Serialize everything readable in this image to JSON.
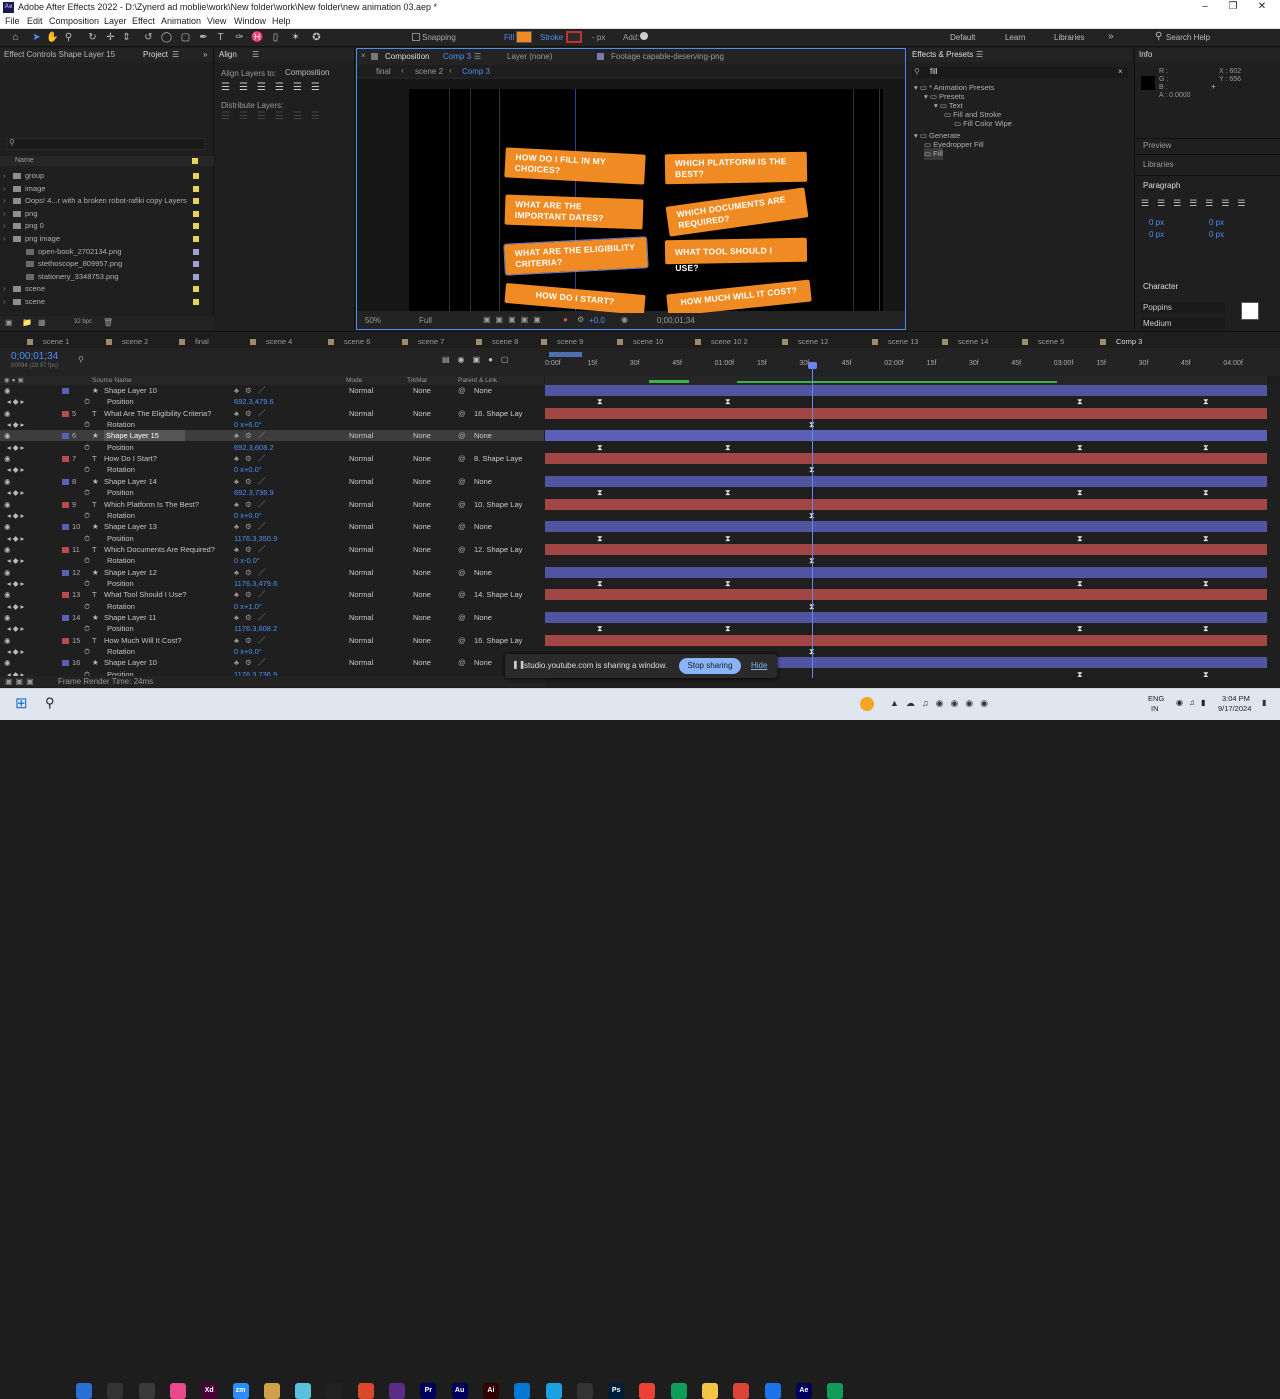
{
  "window": {
    "title": "Adobe After Effects 2022 - D:\\Zynerd ad moblie\\work\\New folder\\work\\New folder\\new animation 03.aep *",
    "app_icon": "Ae"
  },
  "menu": [
    "File",
    "Edit",
    "Composition",
    "Layer",
    "Effect",
    "Animation",
    "View",
    "Window",
    "Help"
  ],
  "toolbar": {
    "snapping": "Snapping",
    "fill": "Fill",
    "stroke": "Stroke",
    "stroke_px": "- px",
    "add": "Add:",
    "workspaces": [
      "Default",
      "Learn",
      "Libraries"
    ],
    "search": "Search Help"
  },
  "left_panel": {
    "effect_controls": "Effect Controls Shape Layer 15",
    "project": "Project",
    "search_placeholder": "",
    "col_name": "Name",
    "items": [
      {
        "name": "group",
        "type": "folder",
        "color": "#e6d45a"
      },
      {
        "name": "image",
        "type": "folder",
        "color": "#e6d45a"
      },
      {
        "name": "Oops! 4...r with a broken robot-rafiki copy Layers",
        "type": "folder",
        "color": "#e6d45a"
      },
      {
        "name": "png",
        "type": "folder",
        "color": "#e6d45a"
      },
      {
        "name": "png 0",
        "type": "folder",
        "color": "#e6d45a"
      },
      {
        "name": "png image",
        "type": "folder",
        "color": "#e6d45a"
      },
      {
        "name": "open-book_2702134.png",
        "type": "file",
        "color": "#a0a0d0"
      },
      {
        "name": "stethoscope_809957.png",
        "type": "file",
        "color": "#a0a0d0"
      },
      {
        "name": "stationery_3348753.png",
        "type": "file",
        "color": "#a0a0d0"
      },
      {
        "name": "scene",
        "type": "folder",
        "color": "#e6d45a"
      },
      {
        "name": "scene",
        "type": "folder",
        "color": "#e6d45a"
      }
    ],
    "bpc": "32 bpc"
  },
  "align_panel": {
    "title": "Align",
    "align_layers_to": "Align Layers to:",
    "target": "Composition",
    "distribute": "Distribute Layers:"
  },
  "comp_panel": {
    "tab": "Composition",
    "comp_name": "Comp 3",
    "layer_tab": "Layer (none)",
    "footage_tab": "Footage capable-deserving-png",
    "breadcrumbs": [
      "final",
      "scene 2",
      "Comp 3"
    ],
    "zoom": "50%",
    "quality": "Full",
    "exposure": "+0.0",
    "timecode": "0;00;01;34",
    "cards": [
      "HOW DO I FILL IN MY CHOICES?",
      "WHAT ARE THE IMPORTANT DATES?",
      "WHAT ARE THE ELIGIBILITY CRITERIA?",
      "HOW DO I START?",
      "WHICH PLATFORM IS THE BEST?",
      "WHICH DOCUMENTS ARE REQUIRED?",
      "WHAT TOOL SHOULD I USE?",
      "HOW MUCH WILL IT COST?"
    ],
    "card_color": "#ef8b22"
  },
  "effects_panel": {
    "title": "Effects & Presets",
    "search": "fill",
    "tree": [
      {
        "label": "* Animation Presets",
        "depth": 0
      },
      {
        "label": "Presets",
        "depth": 1
      },
      {
        "label": "Text",
        "depth": 2
      },
      {
        "label": "Fill and Stroke",
        "depth": 3
      },
      {
        "label": "Fill Color Wipe",
        "depth": 4
      },
      {
        "label": "Generate",
        "depth": 0
      },
      {
        "label": "Eyedropper Fill",
        "depth": 1
      },
      {
        "label": "Fill",
        "depth": 1
      }
    ]
  },
  "info_panel": {
    "title": "Info",
    "r": "R :",
    "g": "G :",
    "b": "B :",
    "a": "A : 0.0000",
    "x": "X : 602",
    "y": "Y : 656"
  },
  "right_panels": {
    "preview": "Preview",
    "libraries": "Libraries",
    "paragraph": "Paragraph",
    "character": "Character",
    "font": "Poppins",
    "weight": "Medium",
    "px0": "0 px"
  },
  "timeline": {
    "tabs": [
      "scene 1",
      "scene 2",
      "final",
      "scene 4",
      "scene 6",
      "scene 7",
      "scene 8",
      "scene 9",
      "scene 10",
      "scene 10 2",
      "scene 12",
      "scene 13",
      "scene 14",
      "scene 5",
      "Comp 3"
    ],
    "timecode": "0;00;01;34",
    "fps": "00094 (29.97 fps)",
    "col_source": "Source Name",
    "col_mode": "Mode",
    "col_trkmat": "TrkMat",
    "col_parent": "Parent & Link",
    "ruler": [
      "0:00f",
      "15f",
      "30f",
      "45f",
      "01:00f",
      "15f",
      "30f",
      "45f",
      "02:00f",
      "15f",
      "30f",
      "45f",
      "03:00f",
      "15f",
      "30f",
      "45f",
      "04:00f"
    ],
    "rows": [
      {
        "num": "",
        "name": "Shape Layer 10",
        "kind": "shape",
        "mode": "Normal",
        "trk": "None",
        "parent": "None",
        "color": "#5a5fb8"
      },
      {
        "num": "",
        "name": "Position",
        "kind": "prop",
        "value": "692.3,479.6"
      },
      {
        "num": "5",
        "name": "What Are The Eligibility  Criteria?",
        "kind": "text",
        "mode": "Normal",
        "trk": "None",
        "parent": "16. Shape Lay",
        "color": "#b84c4c"
      },
      {
        "num": "",
        "name": "Rotation",
        "kind": "prop",
        "value": "0 x+6.0°"
      },
      {
        "num": "6",
        "name": "Shape Layer 15",
        "kind": "shape",
        "mode": "Normal",
        "trk": "None",
        "parent": "None",
        "color": "#5a5fb8",
        "selected": true
      },
      {
        "num": "",
        "name": "Position",
        "kind": "prop",
        "value": "692.3,608.2"
      },
      {
        "num": "7",
        "name": "How Do I Start?",
        "kind": "text",
        "mode": "Normal",
        "trk": "None",
        "parent": "8. Shape Laye",
        "color": "#b84c4c"
      },
      {
        "num": "",
        "name": "Rotation",
        "kind": "prop",
        "value": "0 x+0.0°"
      },
      {
        "num": "8",
        "name": "Shape Layer 14",
        "kind": "shape",
        "mode": "Normal",
        "trk": "None",
        "parent": "None",
        "color": "#5a5fb8"
      },
      {
        "num": "",
        "name": "Position",
        "kind": "prop",
        "value": "692.3,736.9"
      },
      {
        "num": "9",
        "name": "Which Platform Is  The Best?",
        "kind": "text",
        "mode": "Normal",
        "trk": "None",
        "parent": "10. Shape Lay",
        "color": "#b84c4c"
      },
      {
        "num": "",
        "name": "Rotation",
        "kind": "prop",
        "value": "0 x+0.0°"
      },
      {
        "num": "10",
        "name": "Shape Layer 13",
        "kind": "shape",
        "mode": "Normal",
        "trk": "None",
        "parent": "None",
        "color": "#5a5fb8"
      },
      {
        "num": "",
        "name": "Position",
        "kind": "prop",
        "value": "1176.3,350.9"
      },
      {
        "num": "11",
        "name": "Which Documents  Are Required?",
        "kind": "text",
        "mode": "Normal",
        "trk": "None",
        "parent": "12. Shape Lay",
        "color": "#b84c4c"
      },
      {
        "num": "",
        "name": "Rotation",
        "kind": "prop",
        "value": "0 x-0.0°"
      },
      {
        "num": "12",
        "name": "Shape Layer 12",
        "kind": "shape",
        "mode": "Normal",
        "trk": "None",
        "parent": "None",
        "color": "#5a5fb8"
      },
      {
        "num": "",
        "name": "Position",
        "kind": "prop",
        "value": "1176.3,479.6"
      },
      {
        "num": "13",
        "name": "What Tool Should I Use?",
        "kind": "text",
        "mode": "Normal",
        "trk": "None",
        "parent": "14. Shape Lay",
        "color": "#b84c4c"
      },
      {
        "num": "",
        "name": "Rotation",
        "kind": "prop",
        "value": "0 x+1.0°"
      },
      {
        "num": "14",
        "name": "Shape Layer 11",
        "kind": "shape",
        "mode": "Normal",
        "trk": "None",
        "parent": "None",
        "color": "#5a5fb8"
      },
      {
        "num": "",
        "name": "Position",
        "kind": "prop",
        "value": "1176.3,608.2"
      },
      {
        "num": "15",
        "name": "How Much Will It Cost?",
        "kind": "text",
        "mode": "Normal",
        "trk": "None",
        "parent": "16. Shape Lay",
        "color": "#b84c4c"
      },
      {
        "num": "",
        "name": "Rotation",
        "kind": "prop",
        "value": "0 x+0.0°"
      },
      {
        "num": "16",
        "name": "Shape Layer 10",
        "kind": "shape",
        "mode": "Normal",
        "trk": "None",
        "parent": "None",
        "color": "#5a5fb8"
      },
      {
        "num": "",
        "name": "Position",
        "kind": "prop",
        "value": "1176.3,736.9"
      }
    ],
    "render_time": "Frame Render Time:  24ms"
  },
  "share_bar": {
    "text": "studio.youtube.com is sharing a window.",
    "stop": "Stop sharing",
    "hide": "Hide"
  },
  "taskbar": {
    "lang": "ENG",
    "region": "IN",
    "time": "3:04 PM",
    "date": "9/17/2024",
    "apps": [
      {
        "label": "",
        "color": "#2a6fd6"
      },
      {
        "label": "",
        "color": "#333"
      },
      {
        "label": "",
        "color": "#3a3a3a"
      },
      {
        "label": "",
        "color": "#e84a8a"
      },
      {
        "label": "Xd",
        "color": "#470137"
      },
      {
        "label": "zm",
        "color": "#2d8cff"
      },
      {
        "label": "",
        "color": "#cfa24a"
      },
      {
        "label": "",
        "color": "#5bc0de"
      },
      {
        "label": "",
        "color": "#222"
      },
      {
        "label": "",
        "color": "#d9482b"
      },
      {
        "label": "",
        "color": "#5a2d82"
      },
      {
        "label": "Pr",
        "color": "#00005b"
      },
      {
        "label": "Au",
        "color": "#00005b"
      },
      {
        "label": "Ai",
        "color": "#330000"
      },
      {
        "label": "",
        "color": "#0078d4"
      },
      {
        "label": "",
        "color": "#1ba1e2"
      },
      {
        "label": "",
        "color": "#333"
      },
      {
        "label": "Ps",
        "color": "#001e36"
      },
      {
        "label": "",
        "color": "#ea4335"
      },
      {
        "label": "",
        "color": "#0f9d58"
      },
      {
        "label": "",
        "color": "#f4c542"
      },
      {
        "label": "",
        "color": "#db4437"
      },
      {
        "label": "",
        "color": "#1a73e8"
      },
      {
        "label": "Ae",
        "color": "#00005b"
      },
      {
        "label": "",
        "color": "#0f9d58"
      }
    ]
  }
}
